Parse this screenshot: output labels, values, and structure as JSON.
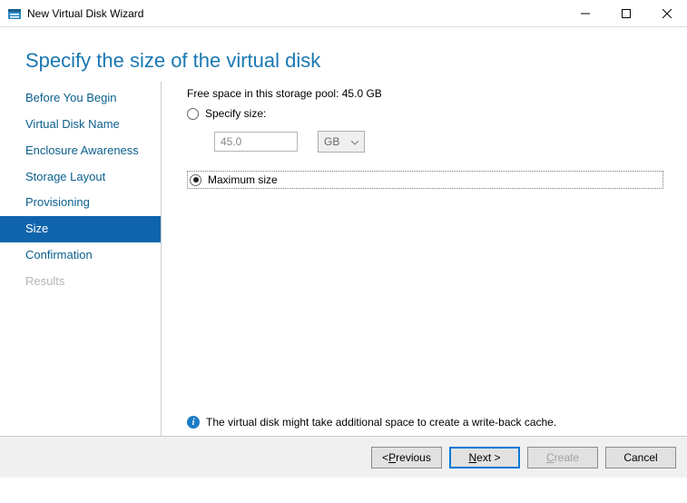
{
  "window": {
    "title": "New Virtual Disk Wizard"
  },
  "heading": "Specify the size of the virtual disk",
  "steps": [
    {
      "label": "Before You Begin"
    },
    {
      "label": "Virtual Disk Name"
    },
    {
      "label": "Enclosure Awareness"
    },
    {
      "label": "Storage Layout"
    },
    {
      "label": "Provisioning"
    },
    {
      "label": "Size"
    },
    {
      "label": "Confirmation"
    },
    {
      "label": "Results"
    }
  ],
  "content": {
    "free_space_label": "Free space in this storage pool: 45.0 GB",
    "specify_size_label": "Specify size:",
    "size_value": "45.0",
    "unit_selected": "GB",
    "maximum_size_label": "Maximum size",
    "selected_option": "maximum"
  },
  "info": {
    "text": "The virtual disk might take additional space to create a write-back cache."
  },
  "buttons": {
    "previous_prefix": "< ",
    "previous_u": "P",
    "previous_rest": "revious",
    "next_u": "N",
    "next_rest": "ext >",
    "create_u": "C",
    "create_rest": "reate",
    "cancel": "Cancel"
  }
}
